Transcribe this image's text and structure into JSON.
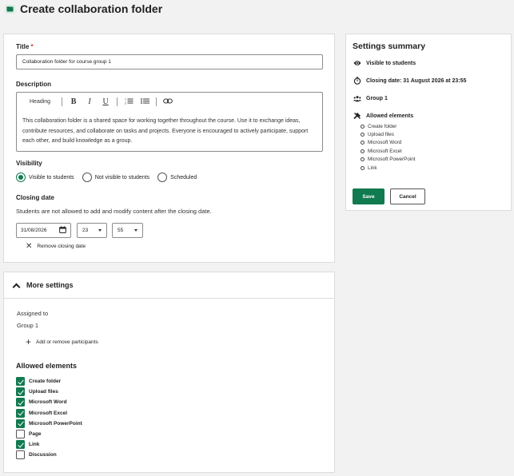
{
  "header": {
    "title": "Create collaboration folder",
    "icon": "folder-icon"
  },
  "form": {
    "title_label": "Title",
    "title_required_mark": "*",
    "title_value": "Collaboration folder for course group 1",
    "description_label": "Description",
    "toolbar": {
      "heading": "Heading",
      "bold": "B",
      "italic": "I",
      "underline": "U",
      "ordered_list": "ordered-list-icon",
      "bullet_list": "bullet-list-icon",
      "link": "link-icon"
    },
    "description_text": "This collaboration folder is a shared space for working together throughout the course. Use it to exchange ideas, contribute resources, and collaborate on tasks and projects. Everyone is encouraged to actively participate, support each other, and build knowledge as a group.",
    "visibility_label": "Visibility",
    "visibility_options": [
      {
        "label": "Visible to students",
        "selected": true
      },
      {
        "label": "Not visible to students",
        "selected": false
      },
      {
        "label": "Scheduled",
        "selected": false
      }
    ],
    "closing_date_label": "Closing date",
    "closing_date_help": "Students are not allowed to add and modify content after the closing date.",
    "closing_date_value": "31/08/2026",
    "hour_value": "23",
    "minute_value": "55",
    "remove_closing_date": "Remove closing date"
  },
  "more_settings": {
    "title": "More settings",
    "assigned_to_label": "Assigned to",
    "assigned_to_value": "Group 1",
    "add_remove_participants": "Add or remove participants",
    "allowed_elements_label": "Allowed elements",
    "elements": [
      {
        "label": "Create folder",
        "checked": true
      },
      {
        "label": "Upload files",
        "checked": true
      },
      {
        "label": "Microsoft Word",
        "checked": true
      },
      {
        "label": "Microsoft Excel",
        "checked": true
      },
      {
        "label": "Microsoft PowerPoint",
        "checked": true
      },
      {
        "label": "Page",
        "checked": false
      },
      {
        "label": "Link",
        "checked": true
      },
      {
        "label": "Discussion",
        "checked": false
      }
    ]
  },
  "summary": {
    "title": "Settings summary",
    "visibility": "Visible to students",
    "closing": "Closing date: 31 August 2026 at 23:55",
    "group": "Group 1",
    "allowed_title": "Allowed elements",
    "allowed_items": [
      "Create folder",
      "Upload files",
      "Microsoft Word",
      "Microsoft Excel",
      "Microsoft PowerPoint",
      "Link"
    ],
    "save_label": "Save",
    "cancel_label": "Cancel"
  },
  "colors": {
    "accent": "#117a4f",
    "required": "#c0392b"
  }
}
